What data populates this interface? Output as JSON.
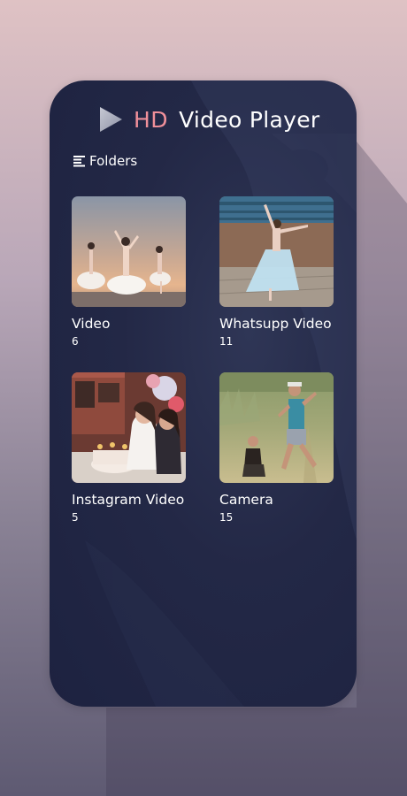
{
  "app": {
    "title_hd": "HD",
    "title_rest": "Video Player"
  },
  "section": {
    "label": "Folders",
    "icon": "folder-list-icon"
  },
  "folders": [
    {
      "name": "Video",
      "count": "6",
      "thumbnail": "ballet-dancers-sunset"
    },
    {
      "name": "Whatsupp Video",
      "count": "11",
      "thumbnail": "dancer-in-blue-dress"
    },
    {
      "name": "Instagram Video",
      "count": "5",
      "thumbnail": "birthday-cake-party"
    },
    {
      "name": "Camera",
      "count": "15",
      "thumbnail": "father-child-grass-field"
    }
  ],
  "colors": {
    "accent": "#f0909a",
    "panel": "#232846",
    "text": "#ffffff"
  }
}
